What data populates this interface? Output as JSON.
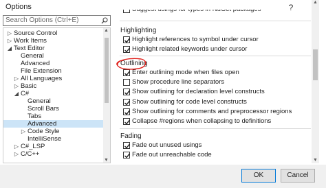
{
  "window": {
    "title": "Options",
    "help_label": "?",
    "close_label": "✕"
  },
  "search": {
    "placeholder": "Search Options (Ctrl+E)"
  },
  "tree": {
    "items": [
      {
        "label": "Source Control",
        "expander": "▷"
      },
      {
        "label": "Work Items",
        "expander": "▷"
      },
      {
        "label": "Text Editor",
        "expander": "◢"
      },
      {
        "label": "General",
        "expander": ""
      },
      {
        "label": "Advanced",
        "expander": ""
      },
      {
        "label": "File Extension",
        "expander": ""
      },
      {
        "label": "All Languages",
        "expander": "▷"
      },
      {
        "label": "Basic",
        "expander": "▷"
      },
      {
        "label": "C#",
        "expander": "◢"
      },
      {
        "label": "General",
        "expander": ""
      },
      {
        "label": "Scroll Bars",
        "expander": ""
      },
      {
        "label": "Tabs",
        "expander": ""
      },
      {
        "label": "Advanced",
        "expander": "",
        "selected": true
      },
      {
        "label": "Code Style",
        "expander": "▷"
      },
      {
        "label": "IntelliSense",
        "expander": ""
      },
      {
        "label": "C#_LSP",
        "expander": "▷"
      },
      {
        "label": "C/C++",
        "expander": "▷"
      }
    ]
  },
  "panel": {
    "top_partial": "Suggest usings for types in NuGet packages",
    "highlighting": {
      "title": "Highlighting",
      "options": [
        {
          "label": "Highlight references to symbol under cursor",
          "checked": true
        },
        {
          "label": "Highlight related keywords under cursor",
          "checked": true
        }
      ]
    },
    "outlining": {
      "title": "Outlining",
      "options": [
        {
          "label": "Enter outlining mode when files open",
          "checked": true
        },
        {
          "label": "Show procedure line separators",
          "checked": false
        },
        {
          "label": "Show outlining for declaration level constructs",
          "checked": true
        },
        {
          "label": "Show outlining for code level constructs",
          "checked": true
        },
        {
          "label": "Show outlining for comments and preprocessor regions",
          "checked": true
        },
        {
          "label": "Collapse #regions when collapsing to definitions",
          "checked": true
        }
      ]
    },
    "fading": {
      "title": "Fading",
      "options": [
        {
          "label": "Fade out unused usings",
          "checked": true
        },
        {
          "label": "Fade out unreachable code",
          "checked": true
        }
      ]
    }
  },
  "buttons": {
    "ok": "OK",
    "cancel": "Cancel"
  },
  "colors": {
    "selection": "#cce4f7",
    "annotation": "#e0201b",
    "accent": "#0078d7"
  }
}
